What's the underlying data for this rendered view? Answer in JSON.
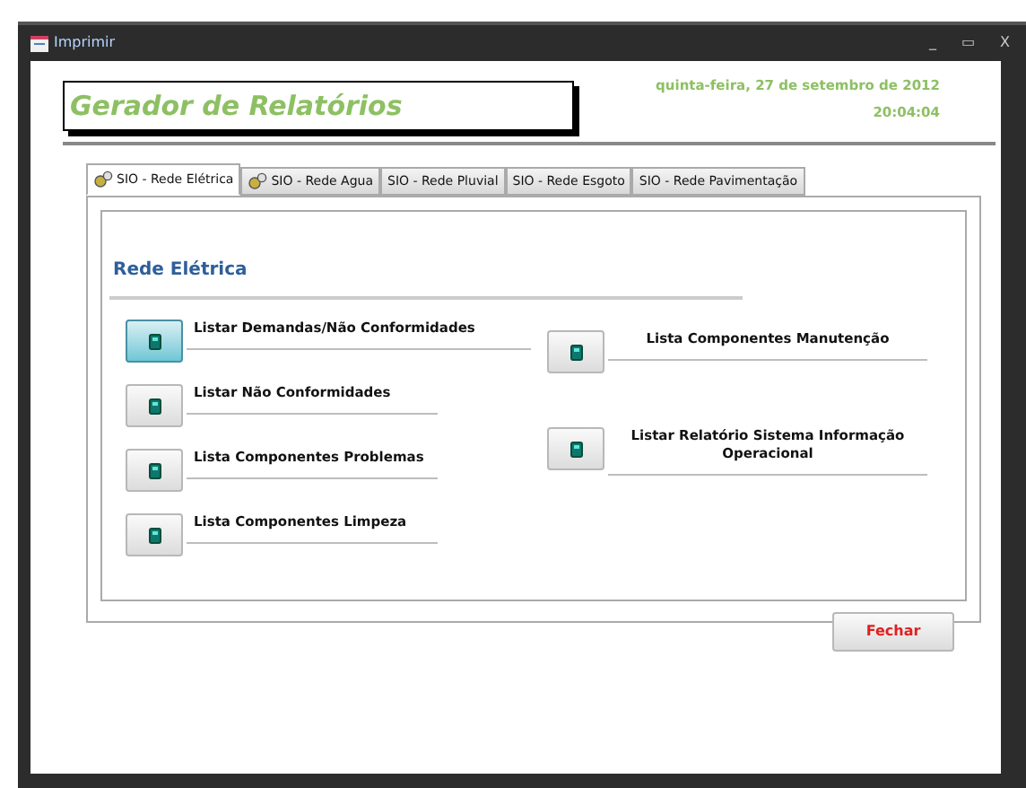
{
  "window": {
    "title": "Imprimir",
    "controls": [
      "_",
      "▭",
      "X"
    ]
  },
  "header": {
    "title": "Gerador de Relatórios",
    "date": "quinta-feira, 27 de setembro de 2012",
    "time": "20:04:04"
  },
  "tabs": [
    {
      "label": "SIO - Rede Elétrica",
      "selected": true,
      "icon": true
    },
    {
      "label": "SIO - Rede Agua",
      "selected": false,
      "icon": true
    },
    {
      "label": "SIO - Rede Pluvial",
      "selected": false,
      "icon": false
    },
    {
      "label": "SIO - Rede Esgoto",
      "selected": false,
      "icon": false
    },
    {
      "label": "SIO - Rede Pavimentação",
      "selected": false,
      "icon": false
    }
  ],
  "section_title": "Rede Elétrica",
  "left_reports": [
    {
      "label": "Listar Demandas/Não Conformidades",
      "focused": true
    },
    {
      "label": "Listar Não Conformidades",
      "focused": false
    },
    {
      "label": "Lista Componentes Problemas",
      "focused": false
    },
    {
      "label": "Lista Componentes Limpeza",
      "focused": false
    }
  ],
  "right_reports": [
    {
      "label": "Lista Componentes Manutenção",
      "focused": false
    },
    {
      "label": "Listar Relatório Sistema Informação Operacional",
      "focused": false
    }
  ],
  "close_button": "Fechar"
}
